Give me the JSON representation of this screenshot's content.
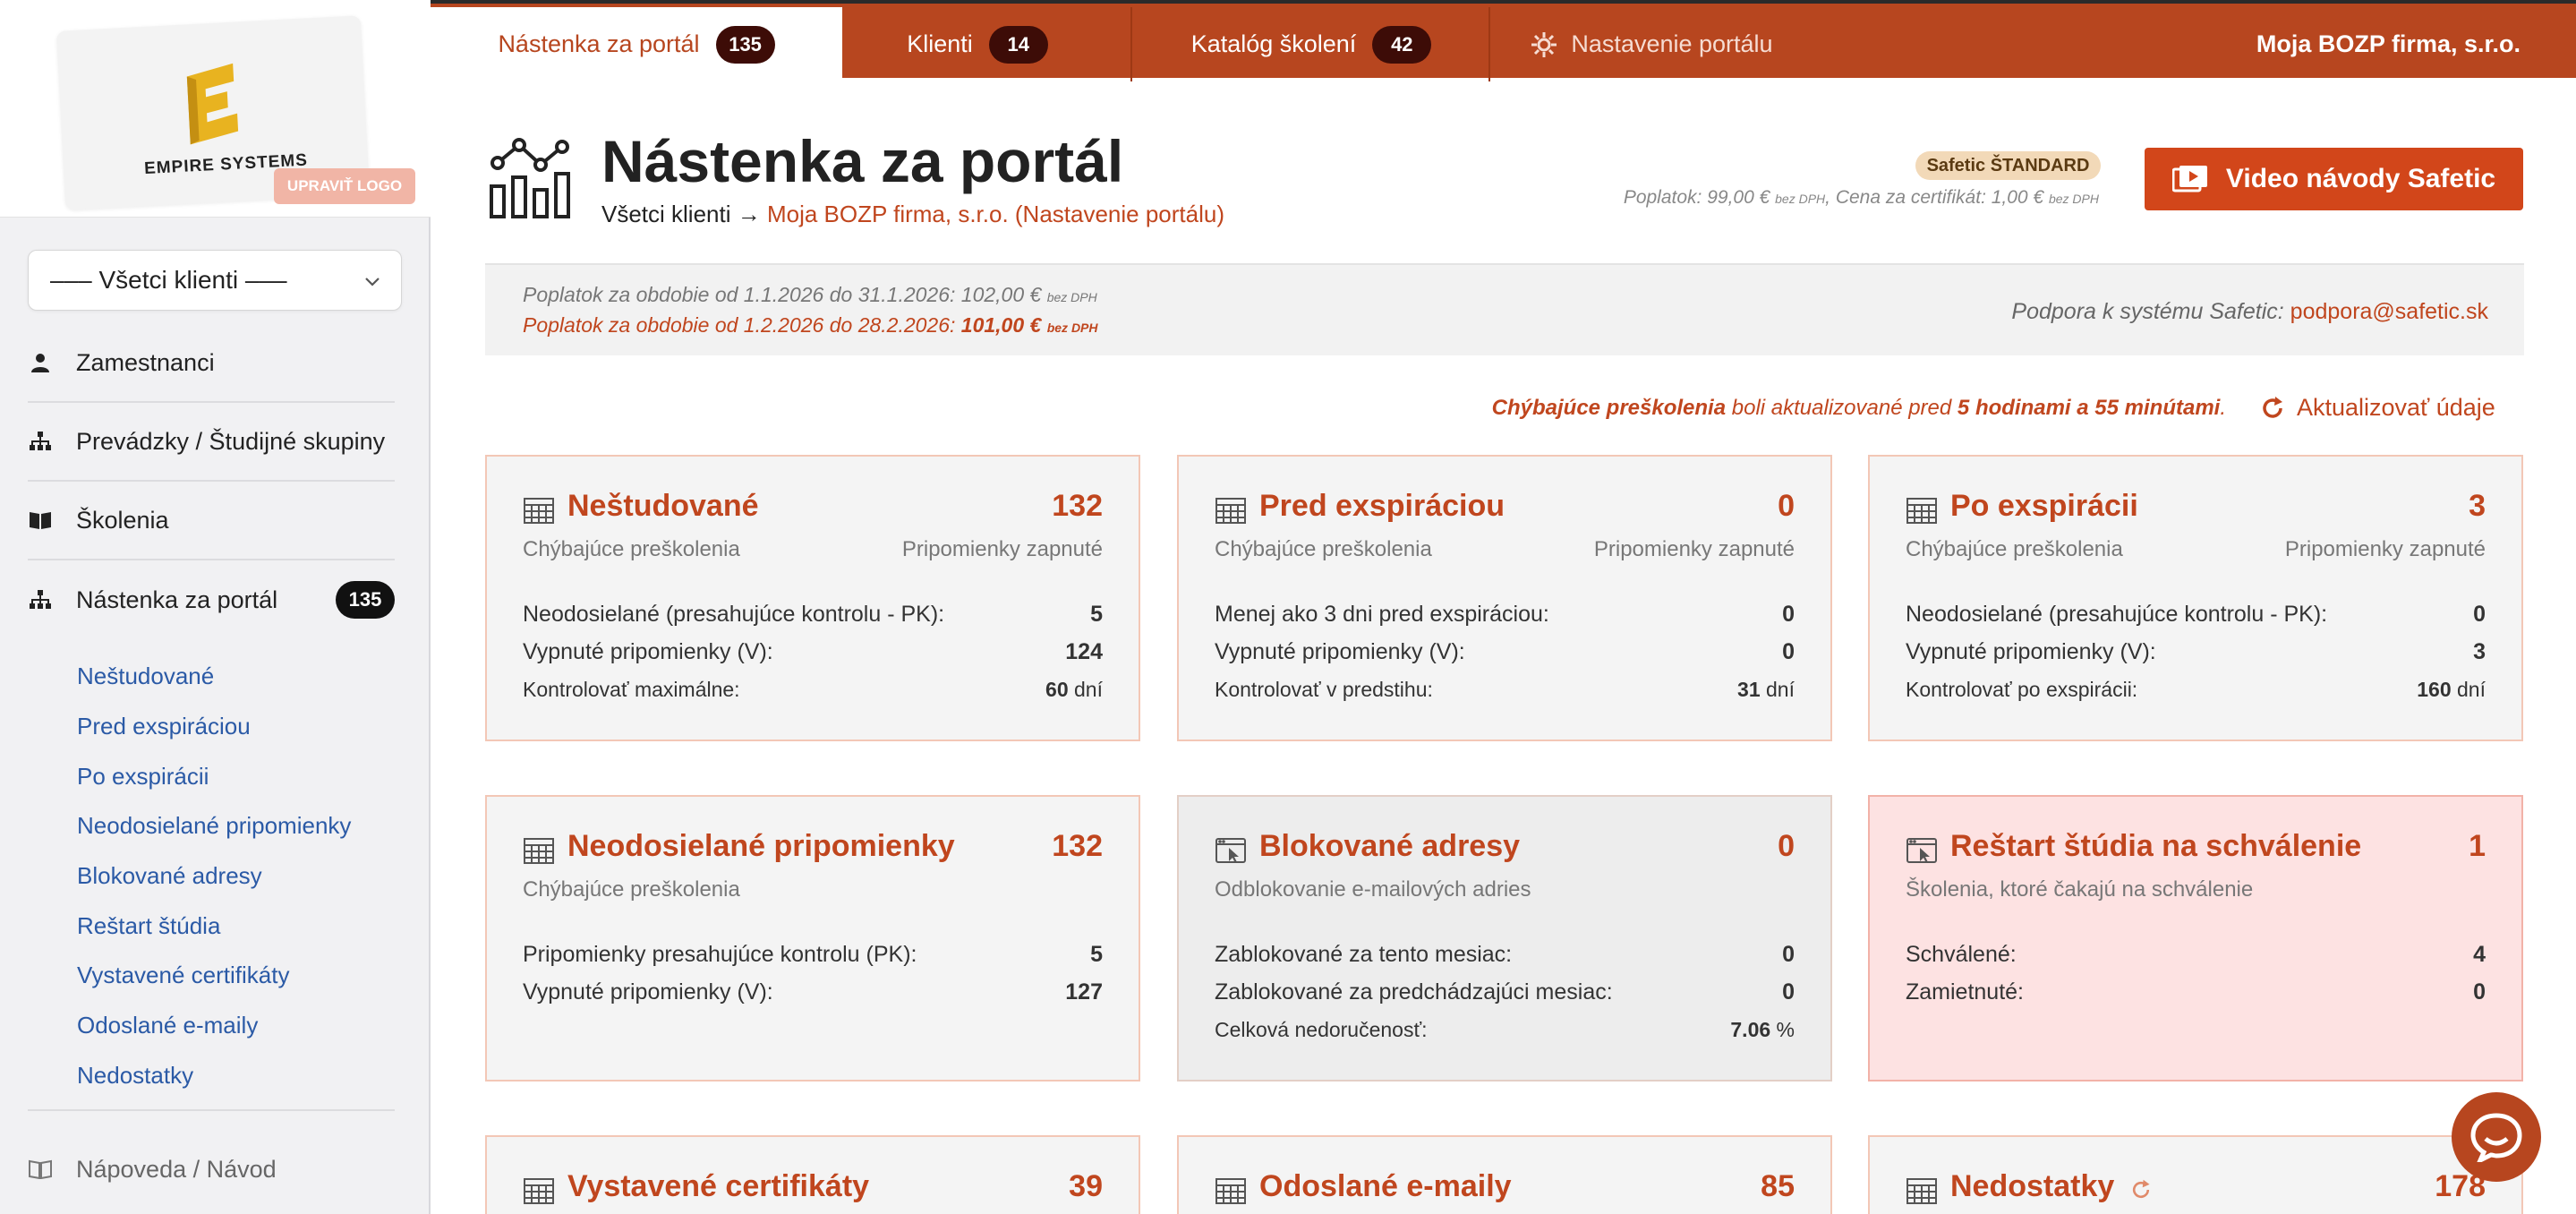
{
  "logo": {
    "brand": "EMPIRE SYSTEMS",
    "edit_label": "UPRAVIŤ LOGO"
  },
  "client_select": {
    "value": "––– Všetci klienti –––"
  },
  "sidebar": {
    "items": [
      {
        "label": "Zamestnanci",
        "icon": "person-icon"
      },
      {
        "label": "Prevádzky / Študijné skupiny",
        "icon": "org-chart-icon"
      },
      {
        "label": "Školenia",
        "icon": "book-icon"
      },
      {
        "label": "Nástenka za portál",
        "icon": "org-chart-icon",
        "badge": "135"
      }
    ],
    "subitems": [
      "Neštudované",
      "Pred exspiráciou",
      "Po exspirácii",
      "Neodosielané pripomienky",
      "Blokované adresy",
      "Reštart štúdia",
      "Vystavené certifikáty",
      "Odoslané e-maily",
      "Nedostatky"
    ],
    "bottom": [
      {
        "label": "Nápoveda / Návod",
        "icon": "book-outline-icon"
      }
    ]
  },
  "topbar": {
    "tabs": [
      {
        "label": "Nástenka za portál",
        "count": "135"
      },
      {
        "label": "Klienti",
        "count": "14"
      },
      {
        "label": "Katalóg školení",
        "count": "42"
      },
      {
        "label": "Nastavenie portálu"
      }
    ],
    "company": "Moja BOZP firma, s.r.o."
  },
  "header": {
    "title": "Nástenka za portál",
    "breadcrumb_root": "Všetci klienti",
    "breadcrumb_arrow": "→",
    "breadcrumb_link": "Moja BOZP firma, s.r.o. (Nastavenie portálu)",
    "plan": "Safetic ŠTANDARD",
    "fee_label": "Poplatok: 99,00 €",
    "fee_unit": "bez DPH",
    "cert_label": ", Cena za certifikát: 1,00 €",
    "cert_unit": "bez DPH",
    "video_button": "Video návody Safetic"
  },
  "period": {
    "line1": "Poplatok za obdobie od 1.1.2026 do 31.1.2026: 102,00 €",
    "line1_unit": "bez DPH",
    "line2_prefix": "Poplatok za obdobie od 1.2.2026 do 28.2.2026: ",
    "line2_amount": "101,00 €",
    "line2_unit": "bez DPH",
    "support_label": "Podpora k systému Safetic: ",
    "support_email": "podpora@safetic.sk"
  },
  "update": {
    "bold1": "Chýbajúce preškolenia",
    "text1": " boli aktualizované pred ",
    "bold2": "5 hodinami a 55 minútami",
    "text2": ".",
    "button": "Aktualizovať údaje"
  },
  "cards": [
    {
      "title": "Neštudované",
      "count": "132",
      "subtitle": "Chýbajúce preškolenia",
      "note": "Pripomienky zapnuté",
      "rows": [
        {
          "label": "Neodosielané (presahujúce kontrolu - PK):",
          "value": "5"
        },
        {
          "label": "Vypnuté pripomienky (V):",
          "value": "124"
        },
        {
          "label": "Kontrolovať maximálne:",
          "value": "60",
          "unit": "dní"
        }
      ]
    },
    {
      "title": "Pred exspiráciou",
      "count": "0",
      "subtitle": "Chýbajúce preškolenia",
      "note": "Pripomienky zapnuté",
      "rows": [
        {
          "label": "Menej ako 3 dni pred exspiráciou:",
          "value": "0"
        },
        {
          "label": "Vypnuté pripomienky (V):",
          "value": "0"
        },
        {
          "label": "Kontrolovať v predstihu:",
          "value": "31",
          "unit": "dní"
        }
      ]
    },
    {
      "title": "Po exspirácii",
      "count": "3",
      "subtitle": "Chýbajúce preškolenia",
      "note": "Pripomienky zapnuté",
      "rows": [
        {
          "label": "Neodosielané (presahujúce kontrolu - PK):",
          "value": "0"
        },
        {
          "label": "Vypnuté pripomienky (V):",
          "value": "3"
        },
        {
          "label": "Kontrolovať po exspirácii:",
          "value": "160",
          "unit": "dní"
        }
      ]
    },
    {
      "title": "Neodosielané pripomienky",
      "count": "132",
      "subtitle": "Chýbajúce preškolenia",
      "note": "",
      "rows": [
        {
          "label": "Pripomienky presahujúce kontrolu (PK):",
          "value": "5"
        },
        {
          "label": "Vypnuté pripomienky (V):",
          "value": "127"
        }
      ]
    },
    {
      "title": "Blokované adresy",
      "count": "0",
      "subtitle": "Odblokovanie e-mailových adries",
      "note": "",
      "rows": [
        {
          "label": "Zablokované za tento mesiac:",
          "value": "0"
        },
        {
          "label": "Zablokované za predchádzajúci mesiac:",
          "value": "0"
        },
        {
          "label": "Celková nedoručenosť:",
          "value": "7.06",
          "unit": "%"
        }
      ]
    },
    {
      "title": "Reštart štúdia na schválenie",
      "count": "1",
      "subtitle": "Školenia, ktoré čakajú na schválenie",
      "note": "",
      "rows": [
        {
          "label": "Schválené:",
          "value": "4"
        },
        {
          "label": "Zamietnuté:",
          "value": "0"
        }
      ]
    },
    {
      "title": "Vystavené certifikáty",
      "count": "39"
    },
    {
      "title": "Odoslané e-maily",
      "count": "85"
    },
    {
      "title": "Nedostatky",
      "count": "178"
    }
  ],
  "colors": {
    "accent": "#b7461f",
    "link": "#2b5aa6",
    "highlight_card": "#fde2e2"
  }
}
